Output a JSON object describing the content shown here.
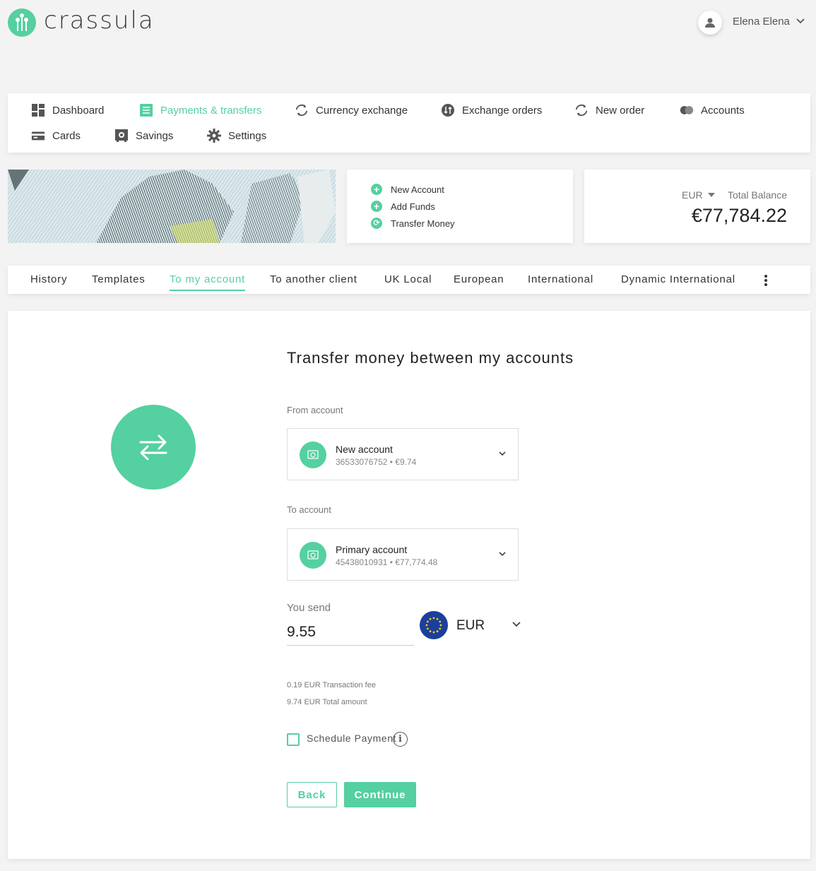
{
  "brand": {
    "name": "crassula",
    "accent": "#55d0a0"
  },
  "user": {
    "name": "Elena Elena"
  },
  "nav": {
    "dashboard": "Dashboard",
    "payments": "Payments & transfers",
    "currency_exchange": "Currency exchange",
    "exchange_orders": "Exchange orders",
    "new_order": "New order",
    "accounts": "Accounts",
    "cards": "Cards",
    "savings": "Savings",
    "settings": "Settings"
  },
  "quick_actions": {
    "new_account": "New Account",
    "add_funds": "Add Funds",
    "transfer_money": "Transfer Money"
  },
  "balance": {
    "currency": "EUR",
    "label": "Total Balance",
    "amount": "€77,784.22"
  },
  "tabs": {
    "history": "History",
    "templates": "Templates",
    "to_my_account": "To my account",
    "to_another_client": "To another client",
    "uk_local": "UK Local",
    "european": "European",
    "international": "International",
    "dynamic_international": "Dynamic International"
  },
  "form": {
    "title": "Transfer money between my accounts",
    "from_label": "From account",
    "from": {
      "name": "New account",
      "details": "36533076752 • €9.74"
    },
    "to_label": "To account",
    "to": {
      "name": "Primary account",
      "details": "45438010931 • €77,774.48"
    },
    "send_label": "You send",
    "send_value": "9.55",
    "currency": "EUR",
    "fee_text": "0.19 EUR Transaction fee",
    "total_text": "9.74 EUR Total amount",
    "schedule_label": "Schedule Payment",
    "back": "Back",
    "continue": "Continue"
  }
}
